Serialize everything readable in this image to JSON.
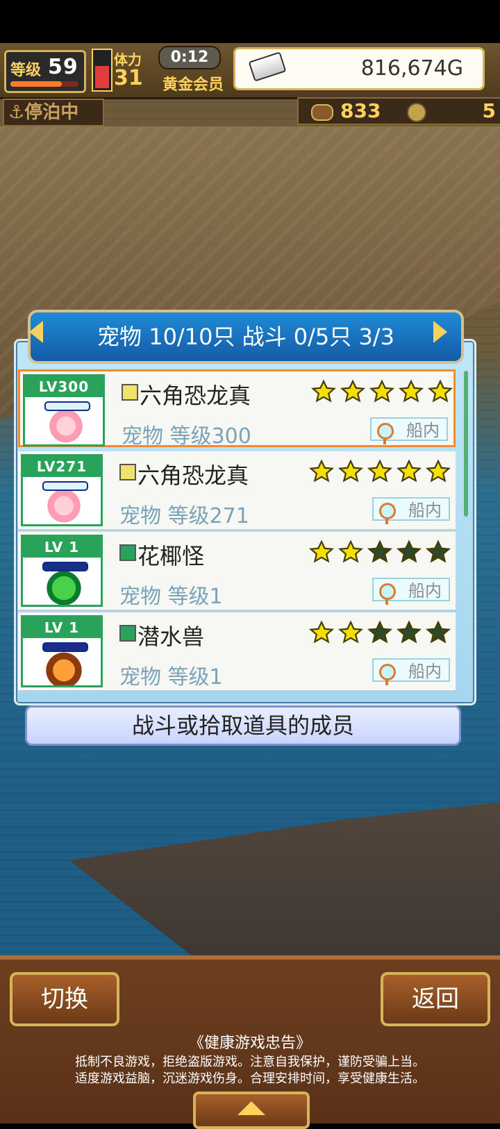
{
  "hud": {
    "level_label": "等级",
    "level_value": "59",
    "vitality_label": "体力",
    "vitality_value": "31",
    "timer": "0:12",
    "membership": "黄金会员",
    "money": "816,674G",
    "status_moored": "⚓停泊中",
    "resource_a": "833",
    "resource_b": "5"
  },
  "panel": {
    "title": "宠物 10/10只 战斗 0/5只  3/3",
    "rows": [
      {
        "lv": "LV300",
        "name": "六角恐龙真",
        "meta": "宠物 等级300",
        "stars_filled": 5,
        "element": "yellow",
        "creature": "pink",
        "loc": "船内",
        "selected": true,
        "hp_style": "light"
      },
      {
        "lv": "LV271",
        "name": "六角恐龙真",
        "meta": "宠物 等级271",
        "stars_filled": 5,
        "element": "yellow",
        "creature": "pink",
        "loc": "船内",
        "selected": false,
        "hp_style": "light"
      },
      {
        "lv": "LV 1",
        "name": "花椰怪",
        "meta": "宠物 等级1",
        "stars_filled": 2,
        "element": "green",
        "creature": "green",
        "loc": "船内",
        "selected": false,
        "hp_style": "blue"
      },
      {
        "lv": "LV 1",
        "name": "潜水兽",
        "meta": "宠物 等级1",
        "stars_filled": 2,
        "element": "green",
        "creature": "orange",
        "loc": "船内",
        "selected": false,
        "hp_style": "blue"
      }
    ],
    "info": "战斗或拾取道具的成员"
  },
  "bottom": {
    "switch_label": "切换",
    "back_label": "返回",
    "notice_title": "《健康游戏忠告》",
    "notice_lines": [
      "抵制不良游戏，拒绝盗版游戏。注意自我保护，谨防受骗上当。",
      "适度游戏益脑，沉迷游戏伤身。合理安排时间，享受健康生活。"
    ]
  },
  "colors": {
    "panel_title": "#1f8bd6",
    "selected_border": "#f38b2a",
    "star_filled": "#f2e100",
    "star_empty": "#2c4a2a"
  }
}
